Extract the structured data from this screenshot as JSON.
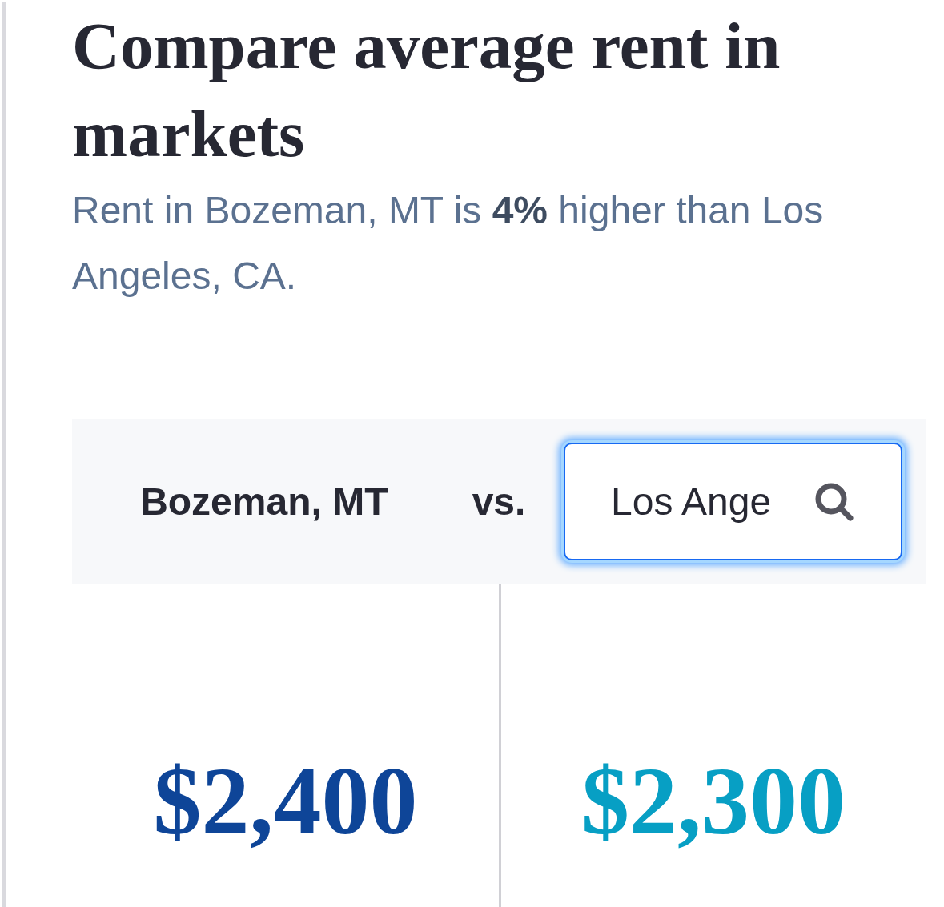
{
  "heading": {
    "title": "Compare average rent in markets",
    "summary": "Rent in Bozeman, MT is **4%** higher than Los Angeles, CA."
  },
  "comparison": {
    "market": "Bozeman, MT",
    "separator": "vs.",
    "search": {
      "value": "Los Ange",
      "focused": true
    }
  },
  "prices": [
    {
      "value": "$2,400",
      "color": "#0e4598"
    },
    {
      "value": "$2,300",
      "color": "#079fc4"
    }
  ]
}
